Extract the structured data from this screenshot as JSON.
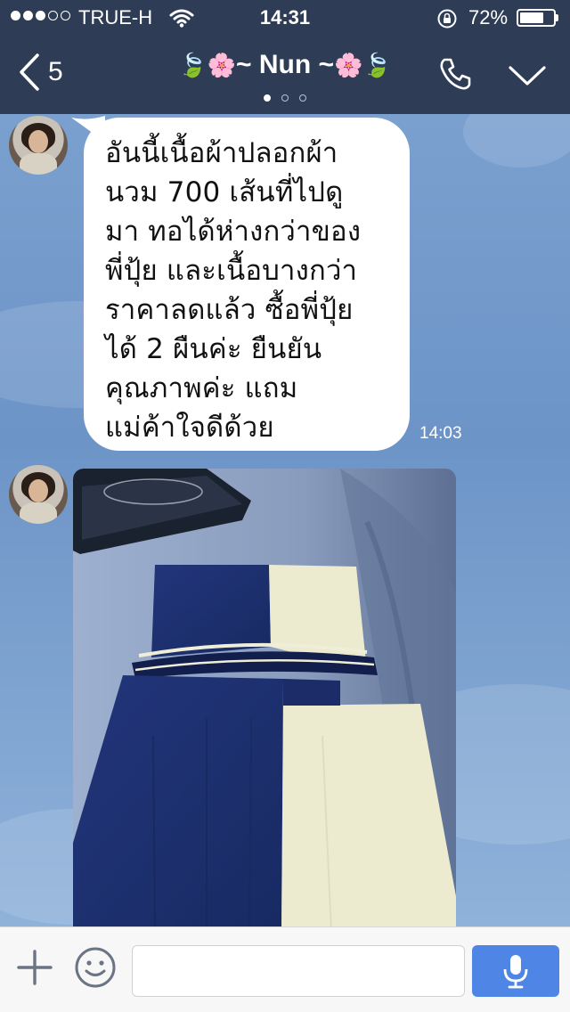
{
  "status_bar": {
    "signal_filled": 3,
    "signal_total": 5,
    "carrier": "TRUE-H",
    "time": "14:31",
    "battery_pct": "72%",
    "battery_level": 0.72
  },
  "header": {
    "back_count": "5",
    "title_left_deco": "🍃🌸",
    "title_text": "~ Nun ~",
    "title_right_deco": "🌸🍃",
    "pager_pages": 3,
    "pager_active": 0
  },
  "messages": [
    {
      "type": "text",
      "lines": [
        "อันนี้เนื้อผ้าปลอกผ้า",
        "นวม 700 เส้นที่ไปดู",
        "มา ทอได้ห่างกว่าของ",
        "พี่ปุ้ย และเนื้อบางกว่า",
        "ราคาลดแล้ว ซื้อพี่ปุ้ย",
        "ได้ 2 ผืนค่ะ ยืนยัน",
        "คุณภาพค่ะ แถม",
        "แม่ค้าใจดีด้วย"
      ],
      "time": "14:03"
    },
    {
      "type": "photo",
      "colors": {
        "navy": "#1d2f6b",
        "cream": "#eeedd3",
        "bedding": "#8fa3c4"
      }
    }
  ],
  "input": {
    "placeholder": "",
    "value": ""
  },
  "icons": {
    "back": "chevron-left-icon",
    "call": "phone-icon",
    "menu": "chevron-down-icon",
    "add": "plus-icon",
    "emoji": "smiley-icon",
    "voice": "microphone-icon"
  },
  "colors": {
    "header_bg": "#2e3d55",
    "chat_bg": "#6f95c8",
    "mic_button": "#4f86e6"
  }
}
